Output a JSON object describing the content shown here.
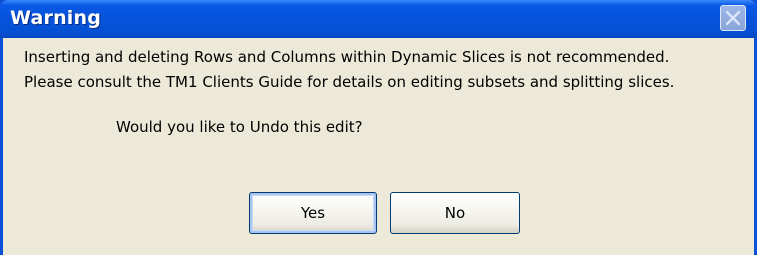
{
  "dialog": {
    "title": "Warning",
    "message_line1": "Inserting and deleting Rows and Columns within Dynamic Slices is not recommended.",
    "message_line2": "Please consult the TM1 Clients Guide for details on editing subsets and splitting slices.",
    "question": "Would you like to Undo this edit?",
    "buttons": {
      "yes_label": "Yes",
      "no_label": "No"
    }
  },
  "icons": {
    "close": "close-icon"
  },
  "colors": {
    "titlebar": "#0652d9",
    "client_background": "#ece9d8",
    "button_border": "#003c74"
  }
}
